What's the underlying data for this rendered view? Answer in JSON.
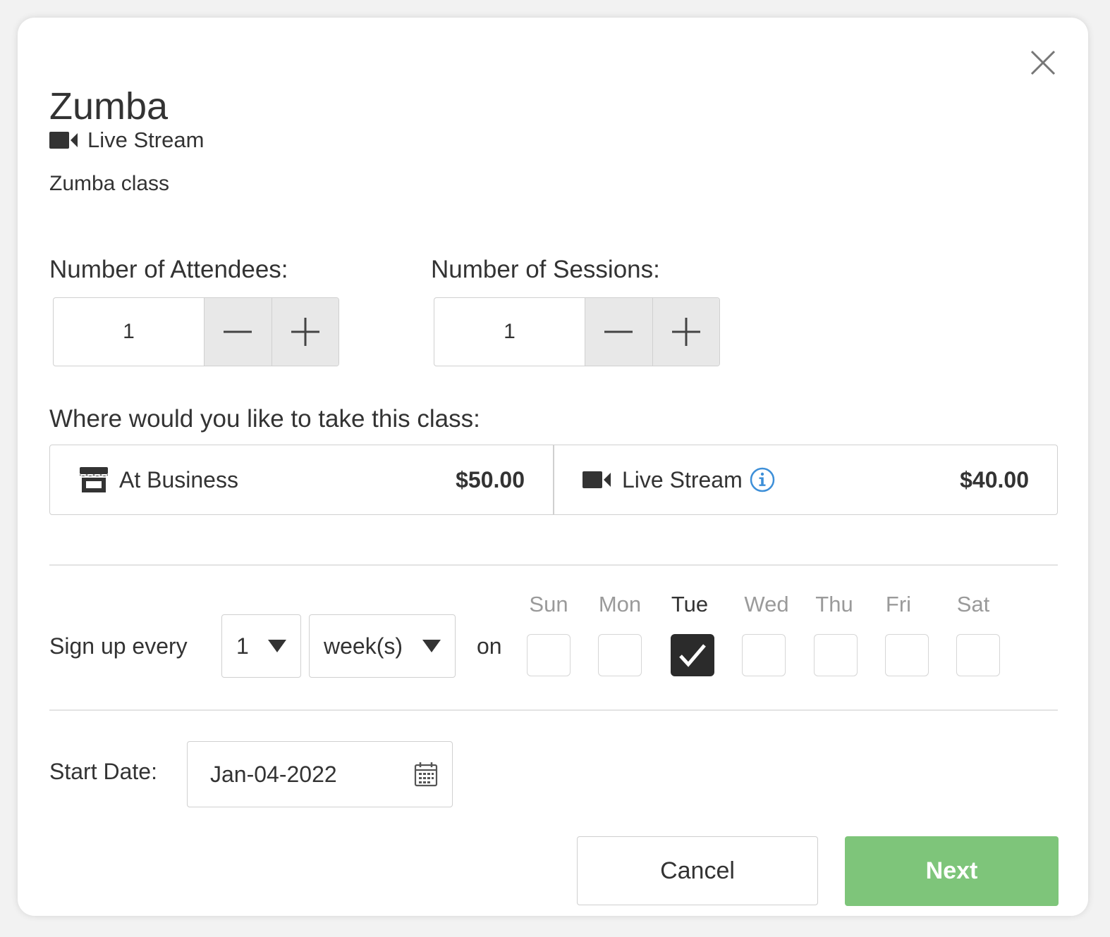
{
  "modal": {
    "title": "Zumba",
    "stream_label": "Live Stream",
    "description": "Zumba class"
  },
  "attendees": {
    "label": "Number of Attendees:",
    "value": "1"
  },
  "sessions": {
    "label": "Number of Sessions:",
    "value": "1"
  },
  "location": {
    "label": "Where would you like to take this class:",
    "options": [
      {
        "name": "At Business",
        "price": "$50.00",
        "icon": "storefront-icon"
      },
      {
        "name": "Live Stream",
        "price": "$40.00",
        "icon": "video-camera-icon"
      }
    ]
  },
  "schedule": {
    "signup_label": "Sign up every",
    "interval_value": "1",
    "unit_value": "week(s)",
    "on_label": "on",
    "days": [
      {
        "name": "Sun",
        "checked": false
      },
      {
        "name": "Mon",
        "checked": false
      },
      {
        "name": "Tue",
        "checked": true
      },
      {
        "name": "Wed",
        "checked": false
      },
      {
        "name": "Thu",
        "checked": false
      },
      {
        "name": "Fri",
        "checked": false
      },
      {
        "name": "Sat",
        "checked": false
      }
    ]
  },
  "start_date": {
    "label": "Start Date:",
    "value": "Jan-04-2022"
  },
  "buttons": {
    "cancel": "Cancel",
    "next": "Next"
  },
  "colors": {
    "accent_green": "#7ec57a",
    "info_blue": "#3d8fd8",
    "checked_box": "#2b2b2b"
  }
}
